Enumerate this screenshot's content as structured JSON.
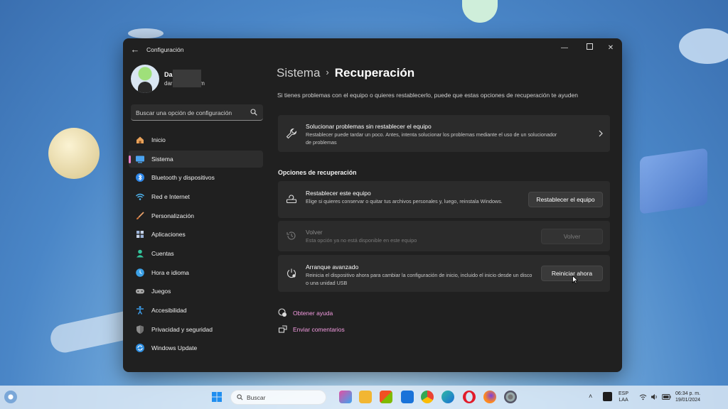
{
  "window": {
    "app_title": "Configuración"
  },
  "profile": {
    "name": "Da",
    "email": "dar            hotmail.com"
  },
  "sidebar": {
    "search_placeholder": "Buscar una opción de configuración",
    "items": [
      {
        "label": "Inicio",
        "icon": "home-icon",
        "color": "#e8a25a"
      },
      {
        "label": "Sistema",
        "icon": "system-icon",
        "color": "#4aa3f0"
      },
      {
        "label": "Bluetooth y dispositivos",
        "icon": "bluetooth-icon",
        "color": "#2f87e8"
      },
      {
        "label": "Red e Internet",
        "icon": "wifi-icon",
        "color": "#4fb4f0"
      },
      {
        "label": "Personalización",
        "icon": "brush-icon",
        "color": "#e9a06a"
      },
      {
        "label": "Aplicaciones",
        "icon": "apps-icon",
        "color": "#9cb3d8"
      },
      {
        "label": "Cuentas",
        "icon": "account-icon",
        "color": "#33c49c"
      },
      {
        "label": "Hora e idioma",
        "icon": "globe-clock-icon",
        "color": "#3ba0e6"
      },
      {
        "label": "Juegos",
        "icon": "gamepad-icon",
        "color": "#a8a8a8"
      },
      {
        "label": "Accesibilidad",
        "icon": "accessibility-icon",
        "color": "#3b9be8"
      },
      {
        "label": "Privacidad y seguridad",
        "icon": "shield-icon",
        "color": "#8c8c8c"
      },
      {
        "label": "Windows Update",
        "icon": "windows-update-icon",
        "color": "#2f8ee0"
      }
    ],
    "selected_index": 1,
    "accent_color": "#ea80c8"
  },
  "main": {
    "breadcrumb_parent": "Sistema",
    "breadcrumb_current": "Recuperación",
    "description": "Si tienes problemas con el equipo o quieres restablecerlo, puede que estas opciones de recuperación te ayuden",
    "troubleshoot": {
      "title": "Solucionar problemas sin restablecer el equipo",
      "desc": "Restablecer puede tardar un poco. Antes, intenta solucionar los problemas mediante el uso de un solucionador de problemas"
    },
    "section_title": "Opciones de recuperación",
    "options": [
      {
        "title": "Restablecer este equipo",
        "desc": "Elige si quieres conservar o quitar tus archivos personales y, luego, reinstala Windows.",
        "button": "Restablecer el equipo",
        "enabled": true
      },
      {
        "title": "Volver",
        "desc": "Esta opción ya no está disponible en este equipo",
        "button": "Volver",
        "enabled": false
      },
      {
        "title": "Arranque avanzado",
        "desc": "Reinicia el dispositivo ahora para cambiar la configuración de inicio, incluido el inicio desde un disco o una unidad USB",
        "button": "Reiniciar ahora",
        "enabled": true
      }
    ],
    "links": [
      {
        "label": "Obtener ayuda",
        "icon": "help-chat-icon"
      },
      {
        "label": "Enviar comentarios",
        "icon": "feedback-icon"
      }
    ],
    "link_color": "#f39be0"
  },
  "taskbar": {
    "search_label": "Buscar",
    "lang_top": "ESP",
    "lang_bottom": "LAA",
    "time": "06:34 p. m.",
    "date": "19/01/2024"
  }
}
